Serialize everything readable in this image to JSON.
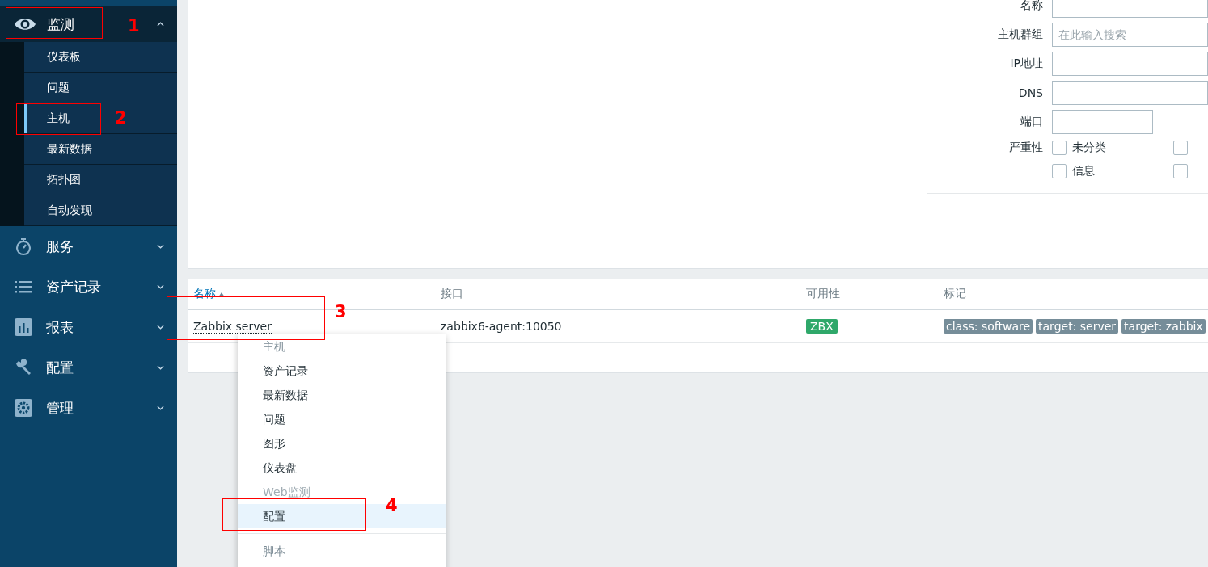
{
  "sidebar": {
    "items": [
      {
        "label": "监测",
        "expanded": true,
        "children": [
          {
            "label": "仪表板",
            "selected": false
          },
          {
            "label": "问题",
            "selected": false
          },
          {
            "label": "主机",
            "selected": true
          },
          {
            "label": "最新数据",
            "selected": false
          },
          {
            "label": "拓扑图",
            "selected": false
          },
          {
            "label": "自动发现",
            "selected": false
          }
        ]
      },
      {
        "label": "服务",
        "expanded": false
      },
      {
        "label": "资产记录",
        "expanded": false
      },
      {
        "label": "报表",
        "expanded": false
      },
      {
        "label": "配置",
        "expanded": false
      },
      {
        "label": "管理",
        "expanded": false
      }
    ]
  },
  "filter": {
    "fields": [
      {
        "label": "名称",
        "kind": "wide"
      },
      {
        "label": "主机群组",
        "kind": "wide",
        "placeholder": "在此输入搜索"
      },
      {
        "label": "IP地址",
        "kind": "wide"
      },
      {
        "label": "DNS",
        "kind": "wide"
      },
      {
        "label": "端口",
        "kind": "short"
      }
    ],
    "severity": {
      "label": "严重性",
      "options": [
        {
          "label": "未分类",
          "checked": false
        },
        {
          "checked": false
        },
        {
          "label": "信息",
          "checked": false
        },
        {
          "checked": false
        }
      ]
    }
  },
  "table": {
    "columns": [
      {
        "label": "名称",
        "sorted": true
      },
      {
        "label": "接口",
        "sorted": false
      },
      {
        "label": "可用性",
        "sorted": false
      },
      {
        "label": "标记",
        "sorted": false
      }
    ],
    "rows": [
      {
        "name": "Zabbix server",
        "interface": "zabbix6-agent:10050",
        "availability": {
          "label": "ZBX",
          "color": "#2fa86a"
        },
        "tags": [
          "class: software",
          "target: server",
          "target: zabbix"
        ]
      }
    ]
  },
  "context_menu": {
    "sections": [
      {
        "heading": "主机",
        "items": [
          {
            "label": "资产记录",
            "disabled": false,
            "selected": false
          },
          {
            "label": "最新数据",
            "disabled": false,
            "selected": false
          },
          {
            "label": "问题",
            "disabled": false,
            "selected": false
          },
          {
            "label": "图形",
            "disabled": false,
            "selected": false
          },
          {
            "label": "仪表盘",
            "disabled": false,
            "selected": false
          },
          {
            "label": "Web监测",
            "disabled": true,
            "selected": false
          },
          {
            "label": "配置",
            "disabled": false,
            "selected": true
          }
        ]
      },
      {
        "heading": "脚本"
      }
    ]
  },
  "annotations": [
    {
      "label": "1"
    },
    {
      "label": "2"
    },
    {
      "label": "3"
    },
    {
      "label": "4"
    }
  ]
}
